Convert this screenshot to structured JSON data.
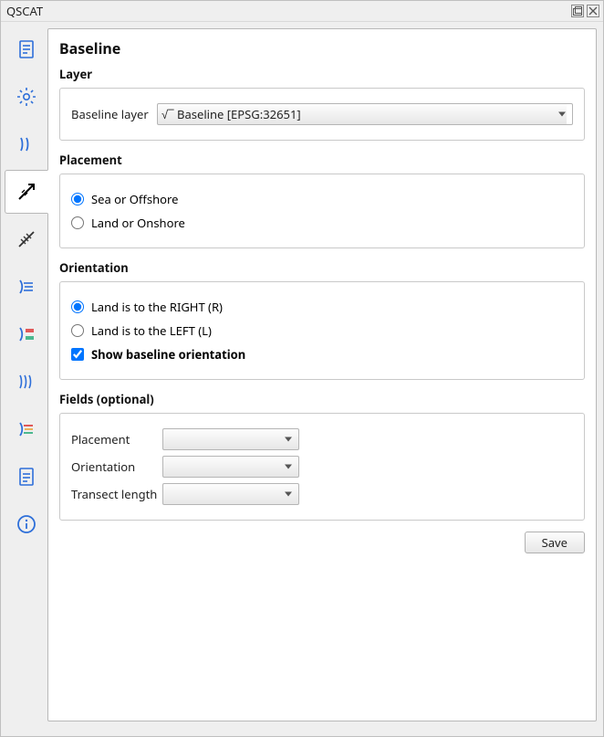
{
  "window": {
    "title": "QSCAT"
  },
  "tabs": [
    {
      "name": "project"
    },
    {
      "name": "settings"
    },
    {
      "name": "shoreline"
    },
    {
      "name": "baseline"
    },
    {
      "name": "transects"
    },
    {
      "name": "shoreline-change"
    },
    {
      "name": "area-change"
    },
    {
      "name": "forecasting"
    },
    {
      "name": "visualization"
    },
    {
      "name": "summary"
    },
    {
      "name": "about"
    }
  ],
  "page": {
    "title": "Baseline",
    "layer": {
      "section": "Layer",
      "label": "Baseline layer",
      "value": "Baseline [EPSG:32651]"
    },
    "placement": {
      "section": "Placement",
      "options": [
        {
          "label": "Sea or Offshore",
          "checked": true
        },
        {
          "label": "Land or Onshore",
          "checked": false
        }
      ]
    },
    "orientation": {
      "section": "Orientation",
      "options": [
        {
          "label": "Land is to the RIGHT (R)",
          "checked": true
        },
        {
          "label": "Land is to the LEFT (L)",
          "checked": false
        }
      ],
      "show_label": "Show baseline orientation",
      "show_checked": true
    },
    "fields": {
      "section": "Fields (optional)",
      "placement_label": "Placement",
      "orientation_label": "Orientation",
      "transect_label": "Transect length",
      "placement_value": "",
      "orientation_value": "",
      "transect_value": ""
    },
    "save_label": "Save"
  }
}
